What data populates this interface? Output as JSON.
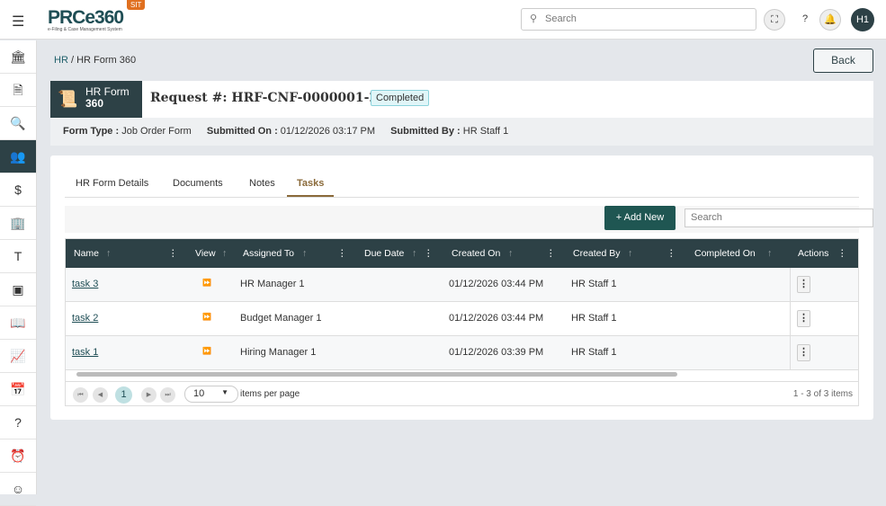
{
  "header": {
    "logo": "PRCe360",
    "logo_sub": "e-Filing & Case Management System",
    "env": "SIT",
    "search_placeholder": "Search",
    "avatar": "H1"
  },
  "sidebar": [
    "bank-icon",
    "document-icon",
    "search-document-icon",
    "users-icon",
    "money-icon",
    "building-icon",
    "text-icon",
    "scan-icon",
    "book-icon",
    "chart-icon",
    "calendar-icon",
    "help-icon",
    "alarm-icon",
    "user-icon"
  ],
  "breadcrumb": {
    "root": "HR",
    "current": "HR Form 360"
  },
  "back_label": "Back",
  "form": {
    "badge_line1": "HR Form",
    "badge_line2": "360",
    "request_label": "Request #:",
    "request_no": "HRF-CNF-0000001-26",
    "status": "Completed",
    "type_label": "Form Type :",
    "type": "Job Order Form",
    "submitted_on_label": "Submitted On :",
    "submitted_on": "01/12/2026 03:17 PM",
    "submitted_by_label": "Submitted By :",
    "submitted_by": "HR Staff 1"
  },
  "tabs": [
    "HR Form Details",
    "Documents",
    "Notes",
    "Tasks"
  ],
  "toolbar": {
    "add_new": "+ Add New",
    "search_placeholder": "Search"
  },
  "columns": [
    "Name",
    "View",
    "Assigned To",
    "Due Date",
    "Created On",
    "Created By",
    "Completed On",
    "Actions"
  ],
  "rows": [
    {
      "name": "task 3",
      "assigned_to": "HR Manager 1",
      "due_date": "",
      "created_on": "01/12/2026 03:44 PM",
      "created_by": "HR Staff 1",
      "completed_on": ""
    },
    {
      "name": "task 2",
      "assigned_to": "Budget Manager 1",
      "due_date": "",
      "created_on": "01/12/2026 03:44 PM",
      "created_by": "HR Staff 1",
      "completed_on": ""
    },
    {
      "name": "task 1",
      "assigned_to": "Hiring Manager 1",
      "due_date": "",
      "created_on": "01/12/2026 03:39 PM",
      "created_by": "HR Staff 1",
      "completed_on": ""
    }
  ],
  "pager": {
    "current_page": "1",
    "page_size": "10",
    "per_page_label": "items per page",
    "summary": "1 - 3 of 3 items"
  }
}
